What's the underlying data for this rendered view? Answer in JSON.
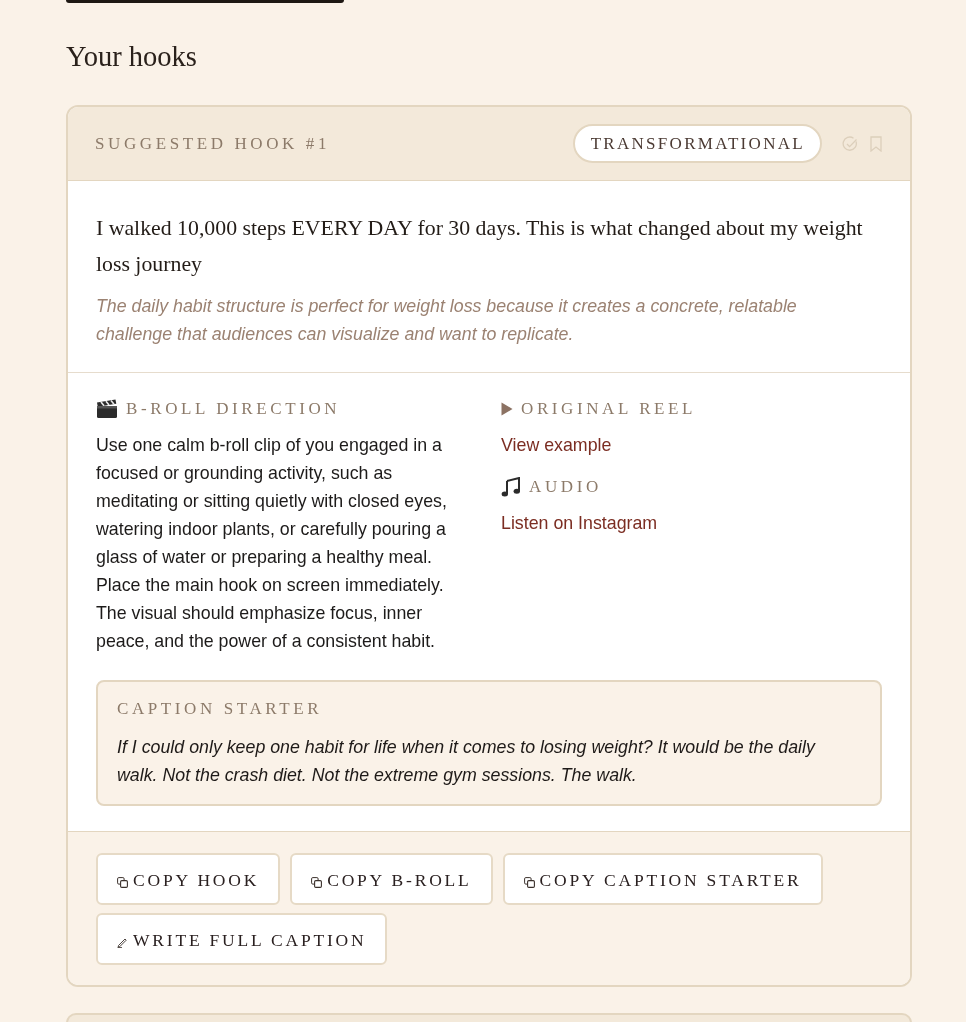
{
  "page": {
    "heading": "Your hooks"
  },
  "hooks": [
    {
      "label": "SUGGESTED HOOK #1",
      "category": "TRANSFORMATIONAL",
      "done": false,
      "saved": false,
      "hook": "I walked 10,000 steps EVERY DAY for 30 days. This is what changed about my weight loss journey",
      "reason": "The daily habit structure is perfect for weight loss because it creates a concrete, relatable challenge that audiences can visualize and want to replicate.",
      "broll": {
        "title": "B-ROLL DIRECTION",
        "text": "Use one calm b-roll clip of you engaged in a focused or grounding activity, such as meditating or sitting quietly with closed eyes, watering indoor plants, or carefully pouring a glass of water or preparing a healthy meal. Place the main hook on screen immediately. The visual should emphasize focus, inner peace, and the power of a consistent habit."
      },
      "links": [
        {
          "kind": "reel",
          "title": "ORIGINAL REEL",
          "link": "View example"
        },
        {
          "kind": "audio",
          "title": "AUDIO",
          "link": "Listen on Instagram"
        }
      ],
      "caption": {
        "title": "CAPTION STARTER",
        "text": "If I could only keep one habit for life when it comes to losing weight? It would be the daily walk. Not the crash diet. Not the extreme gym sessions. The walk."
      },
      "actions": [
        {
          "kind": "copy",
          "label": "COPY HOOK"
        },
        {
          "kind": "copy",
          "label": "COPY B-ROLL"
        },
        {
          "kind": "copy",
          "label": "COPY CAPTION STARTER"
        },
        {
          "kind": "write",
          "label": "WRITE FULL CAPTION"
        }
      ]
    }
  ]
}
